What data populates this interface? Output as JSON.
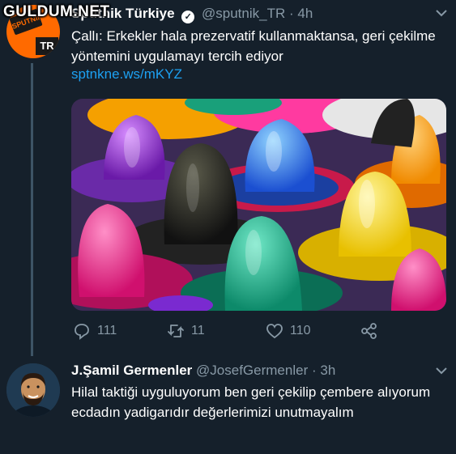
{
  "watermark": "GULDUM.NET",
  "tweet1": {
    "avatar_text_top": "SPUTNIK",
    "avatar_text_bottom": "TR",
    "name": "Sputnik Türkiye",
    "handle": "@sputnik_TR",
    "separator": "·",
    "time": "4h",
    "text": "Çallı: Erkekler hala prezervatif kullanmaktansa, geri çekilme yöntemini uygulamayı tercih ediyor",
    "link": "sptnkne.ws/mKYZ",
    "replies": "111",
    "retweets": "11",
    "likes": "110"
  },
  "tweet2": {
    "name": "J.Şamil Germenler",
    "handle": "@JosefGermenler",
    "separator": "·",
    "time": "3h",
    "text": "Hilal taktiği uyguluyorum ben geri çekilip çembere alıyorum ecdadın yadigarıdır değerlerimizi unutmayalım"
  },
  "icons": {
    "verified": "verified-badge-icon",
    "more": "chevron-down-icon",
    "reply": "reply-icon",
    "retweet": "retweet-icon",
    "like": "heart-icon",
    "share": "share-icon"
  },
  "colors": {
    "background": "#15202b",
    "secondary_text": "#8899a6",
    "link": "#1da1f2",
    "thread_line": "#3d5466"
  }
}
